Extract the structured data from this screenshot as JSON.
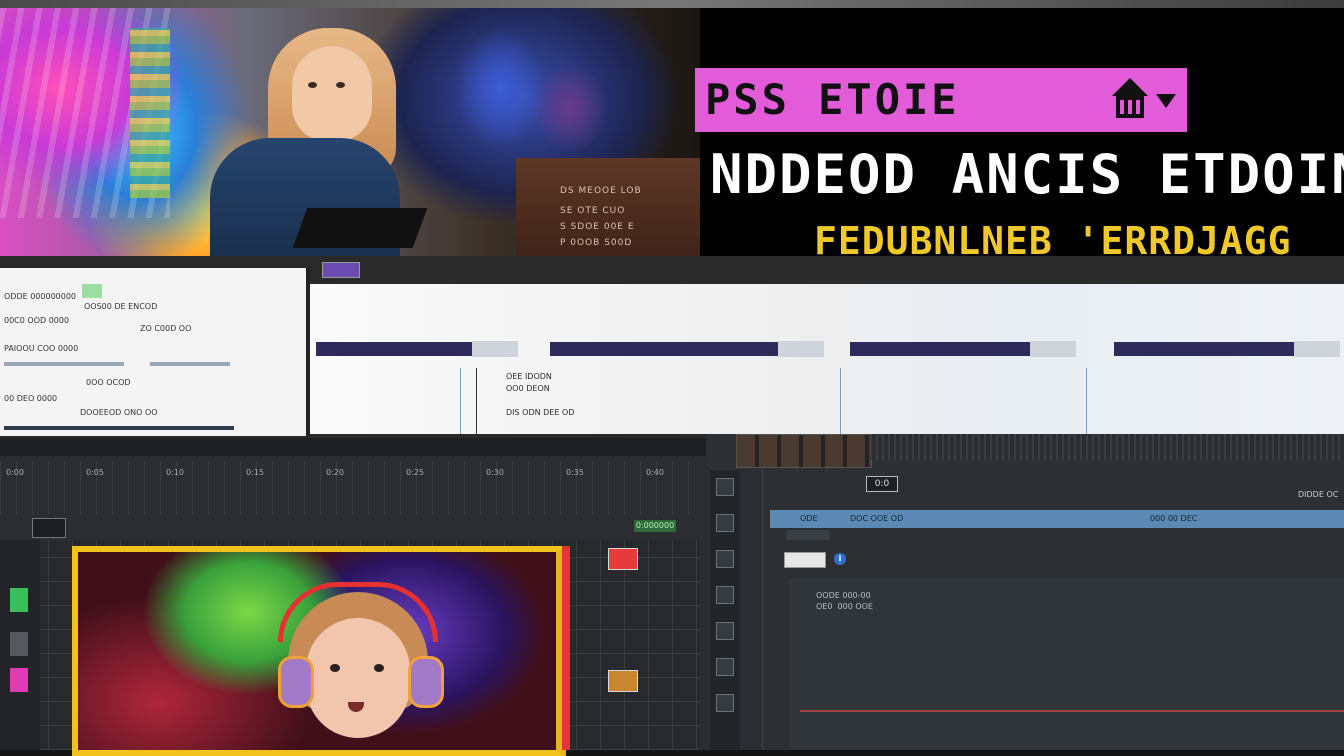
{
  "banner": {
    "pink_label": "PSS ETOIE",
    "headline": "NDDEOD ANCIS ETDOIN!",
    "subline": "FEDUBNLNEB 'ERRDJAGG",
    "podium_lines": [
      "DS MEOOE LOB",
      "SE OTE CUO",
      "S SDOE 00E E",
      "P 0OOB S00D"
    ]
  },
  "doc_panel": {
    "rows": [
      "ODDE 000000000",
      "OOS00 DE ENCOD",
      "00C0 OOD 0000",
      "ZO C00D OO",
      "PAIOOU COO 0000",
      "0OO OCOD",
      "00 DEO 0000",
      "DOOEEOD ONO OO"
    ]
  },
  "sequence_panel": {
    "cell_labels": [
      "OEE IDODN",
      "OO0 DEON",
      "DIS ODN DEE OD"
    ]
  },
  "editor_left": {
    "tick_labels": [
      "0:00",
      "0:05",
      "0:10",
      "0:15",
      "0:20",
      "0:25",
      "0:30",
      "0:35",
      "0:40"
    ],
    "preview_status": "0:000000"
  },
  "editor_right": {
    "time_readout": "0:0",
    "rt_label": "DIDDE OC",
    "track_text_left": "ODE",
    "track_text_mid": "DOC OOE OD",
    "track_text_right": "000 00 DEC",
    "info_lines": "OODE 000-00\nOE0  000 OOE",
    "info_icon": "i"
  },
  "colors": {
    "pink": "#e25bd9",
    "yellow_text": "#f0c928",
    "frame_yellow": "#f1c21b",
    "track_blue": "#5b89b3",
    "seq_bar": "#2e2a5a"
  }
}
